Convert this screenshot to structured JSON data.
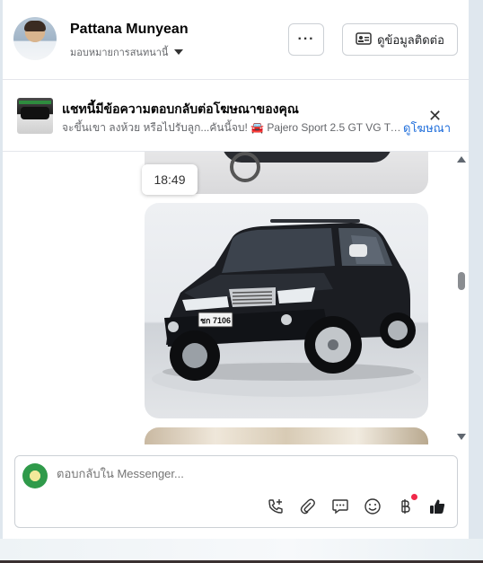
{
  "header": {
    "name": "Pattana Munyean",
    "subtitle": "มอบหมายการสนทนานี้",
    "more_label": "···",
    "contact_label": "ดูข้อมูลติดต่อ"
  },
  "ad_banner": {
    "title": "แชทนี้มีข้อความตอบกลับต่อโฆษณาของคุณ",
    "description": "จะขึ้นเขา ลงห้วย หรือไปรับลูก...คันนี้จบ! 🚘 Pajero Sport 2.5 GT VG Tur...",
    "link_label": "ดูโฆษณา",
    "close_label": "✕"
  },
  "messages": {
    "timestamp": "18:49",
    "license_plate": "ชก 7106"
  },
  "composer": {
    "placeholder": "ตอบกลับใน Messenger...",
    "tools": [
      "call-add-icon",
      "paperclip-icon",
      "saved-reply-icon",
      "emoji-icon",
      "baht-icon",
      "like-icon"
    ]
  },
  "colors": {
    "accent": "#216fdb",
    "like": "#1c1e21",
    "notification": "#f02849"
  }
}
